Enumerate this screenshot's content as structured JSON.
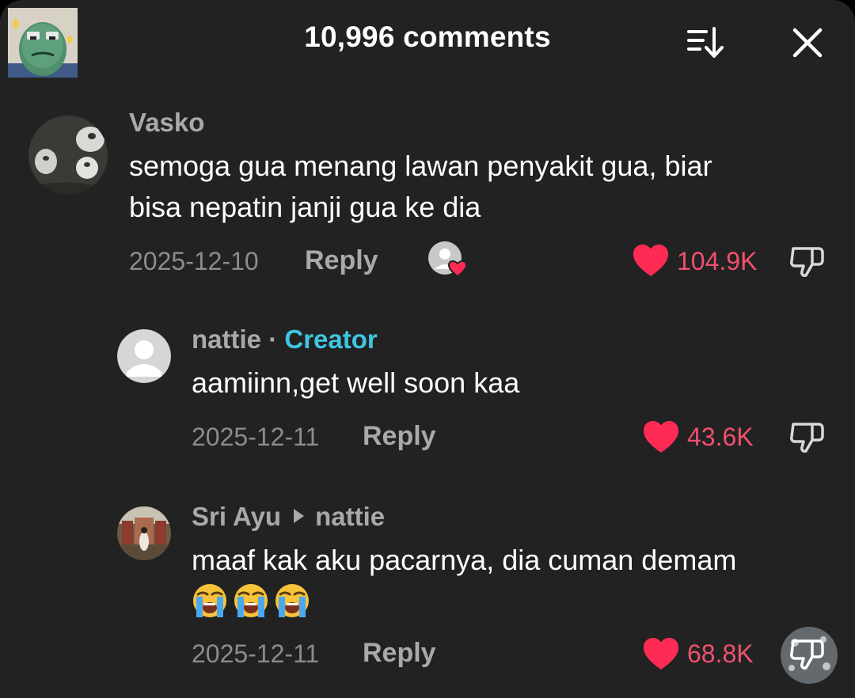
{
  "header": {
    "title": "10,996 comments",
    "sort_icon": "sort-icon",
    "close_icon": "close-icon"
  },
  "comments": [
    {
      "username": "Vasko",
      "text_lines": [
        "semoga gua menang lawan penyakit gua, biar",
        "bisa nepatin janji gua ke dia"
      ],
      "date": "2025-12-10",
      "reply_label": "Reply",
      "likes": "104.9K",
      "creator_liked": true
    },
    {
      "username": "nattie",
      "separator": "·",
      "badge": "Creator",
      "text": "aamiinn,get well soon kaa",
      "date": "2025-12-11",
      "reply_label": "Reply",
      "likes": "43.6K"
    },
    {
      "username": "Sri Ayu",
      "reply_to": "nattie",
      "text": "maaf kak aku pacarnya, dia cuman demam",
      "emojis": [
        "loudly-crying-face",
        "loudly-crying-face",
        "loudly-crying-face"
      ],
      "date": "2025-12-11",
      "reply_label": "Reply",
      "likes": "68.8K"
    }
  ],
  "colors": {
    "background": "#222222",
    "username": "#a9a9a9",
    "creator": "#3ec6e0",
    "like": "#f0506e",
    "date": "#8c8c8c"
  }
}
